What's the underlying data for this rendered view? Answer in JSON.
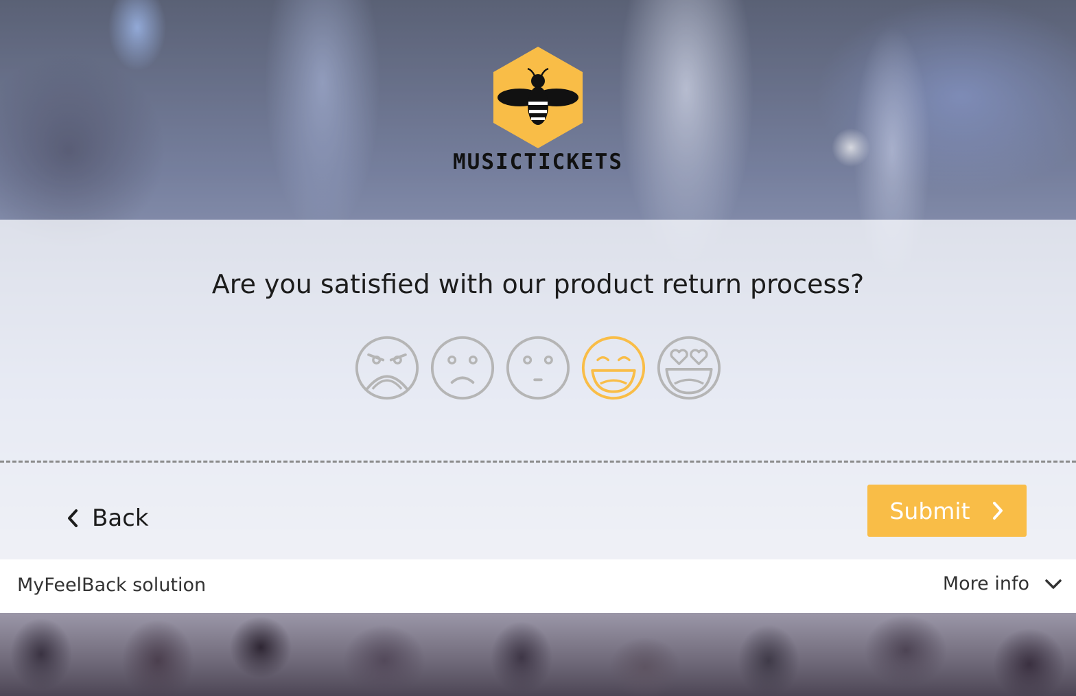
{
  "brand": {
    "name": "MUSICTICKETS",
    "logo_icon": "bee-icon",
    "hex_color": "#f9bd47"
  },
  "survey": {
    "question": "Are you satisfied with our product return process?",
    "rating_options": [
      {
        "name": "very-dissatisfied",
        "icon": "angry-face-icon"
      },
      {
        "name": "dissatisfied",
        "icon": "sad-face-icon"
      },
      {
        "name": "neutral",
        "icon": "neutral-face-icon"
      },
      {
        "name": "satisfied",
        "icon": "smiling-face-icon"
      },
      {
        "name": "very-satisfied",
        "icon": "heart-eyes-face-icon"
      }
    ],
    "selected_rating": 4
  },
  "nav": {
    "back_label": "Back",
    "submit_label": "Submit"
  },
  "footer": {
    "credit": "MyFeelBack solution",
    "more_info_label": "More info"
  },
  "colors": {
    "accent": "#f9bd47",
    "face_inactive": "#b5b5b5",
    "face_active": "#f9bd47"
  }
}
